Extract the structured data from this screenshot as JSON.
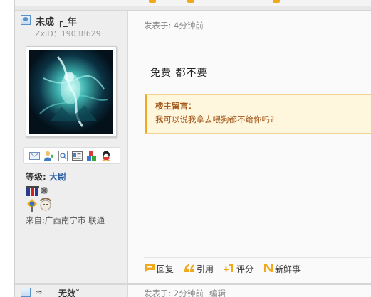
{
  "author": {
    "username": "未成 ┌_年",
    "zxid": "ZxID：19038629",
    "level_label": "等级:",
    "level_rank": "大尉",
    "location": "来自:广西南宁市  联通",
    "icons": [
      "mail-icon",
      "add-friend-icon",
      "profile-icon",
      "card-icon",
      "blocks-icon",
      "qq-icon"
    ]
  },
  "post": {
    "posted_at": "发表于: 4分钟前",
    "text": "免费  都不要",
    "owner_note": {
      "title": "楼主留言：",
      "body": "我可以说我拿去喂狗都不给你吗?"
    },
    "actions": {
      "reply": "回复",
      "quote": "引用",
      "rate": "评分",
      "fresh": "新鲜事"
    }
  },
  "next_post": {
    "username_a": "≈",
    "username_b": "无效ˇ",
    "posted_at": "发表于: 2分钟前",
    "edit": "编辑"
  },
  "colors": {
    "accent_orange": "#f0a81c",
    "note_bg": "#fff6de",
    "note_text": "#a4581a",
    "rank_blue": "#2d5fa5"
  }
}
